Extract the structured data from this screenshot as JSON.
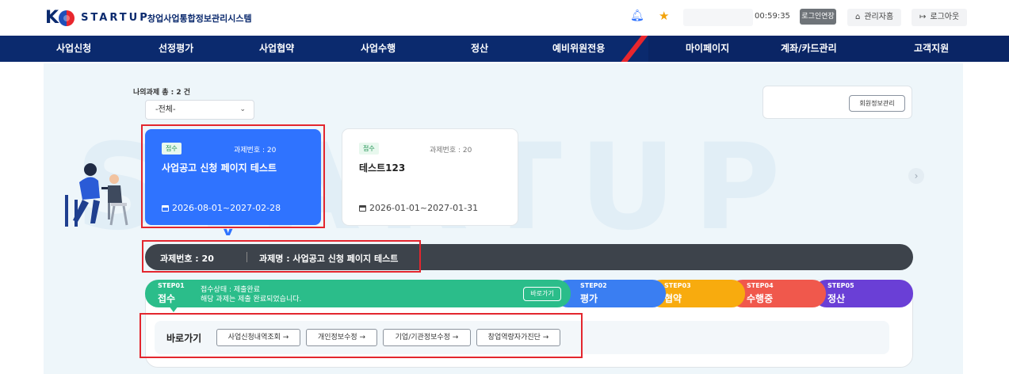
{
  "header": {
    "logo_k": "K",
    "logo_text": "STARTUP",
    "system_title": "창업사업통합정보관리시스템",
    "timer": "00:59:35",
    "extend_login": "로그인연장",
    "admin": "관리자홈",
    "logout": "로그아웃"
  },
  "nav": [
    "사업신청",
    "선정평가",
    "사업협약",
    "사업수행",
    "정산",
    "예비위원전용",
    "마이페이지",
    "계좌/카드관리",
    "고객지원"
  ],
  "projects": {
    "count_label": "나의과제 총 : 2 건",
    "filter_value": "-전체-",
    "member_button": "회원정보관리",
    "cards": [
      {
        "badge": "접수",
        "number": "과제번호 : 20",
        "title": "사업공고 신청 페이지 테스트",
        "date": "2026-08-01~2027-02-28"
      },
      {
        "badge": "접수",
        "number": "과제번호 : 20",
        "title": "테스트123",
        "date": "2026-01-01~2027-01-31"
      }
    ]
  },
  "info_bar": {
    "number": "과제번호 : 20",
    "name": "과제명 : 사업공고 신청 페이지 테스트"
  },
  "steps": [
    {
      "label": "STEP01",
      "name": "접수",
      "status": "접수상태 : 제출완료",
      "desc": "해당 과제는 제출 완료되었습니다.",
      "button": "바로가기"
    },
    {
      "label": "STEP02",
      "name": "평가"
    },
    {
      "label": "STEP03",
      "name": "협약"
    },
    {
      "label": "STEP04",
      "name": "수행중"
    },
    {
      "label": "STEP05",
      "name": "정산"
    }
  ],
  "quick": {
    "label": "바로가기",
    "buttons": [
      "사업신청내역조회 →",
      "개인정보수정 →",
      "기업/기관정보수정 →",
      "창업역량자가진단 →"
    ]
  },
  "watermark": "STARTUP",
  "colors": {
    "navy": "#0b2a6e",
    "blue": "#2f73ff",
    "green": "#2bbd8a",
    "yellow": "#f8ab0e",
    "red": "#f0584c",
    "purple": "#6a3fd6",
    "highlight": "#e3262e"
  }
}
